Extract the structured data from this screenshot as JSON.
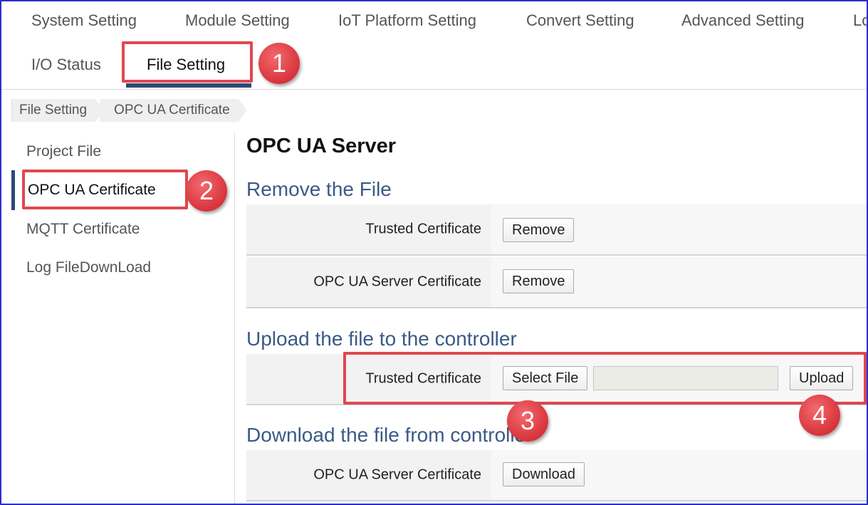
{
  "top_nav": {
    "row1": [
      "System Setting",
      "Module Setting",
      "IoT Platform Setting",
      "Convert Setting",
      "Advanced Setting",
      "Lo"
    ],
    "row2": [
      "I/O Status",
      "File Setting"
    ]
  },
  "breadcrumb": [
    "File Setting",
    "OPC UA Certificate"
  ],
  "sidebar": {
    "items": [
      "Project File",
      "OPC UA Certificate",
      "MQTT Certificate",
      "Log FileDownLoad"
    ]
  },
  "main": {
    "title": "OPC UA Server",
    "remove_section": {
      "title": "Remove the File",
      "rows": [
        {
          "label": "Trusted Certificate",
          "button": "Remove"
        },
        {
          "label": "OPC UA Server Certificate",
          "button": "Remove"
        }
      ]
    },
    "upload_section": {
      "title": "Upload the file to the controller",
      "label": "Trusted Certificate",
      "select_button": "Select File",
      "upload_button": "Upload"
    },
    "download_section": {
      "title": "Download the file from controller",
      "label": "OPC UA Server Certificate",
      "button": "Download"
    }
  },
  "annotations": [
    "1",
    "2",
    "3",
    "4"
  ],
  "colors": {
    "accent": "#2c4a78",
    "section_title": "#3b5a85",
    "callout": "#e0474f",
    "frame": "#2d2dcc"
  }
}
